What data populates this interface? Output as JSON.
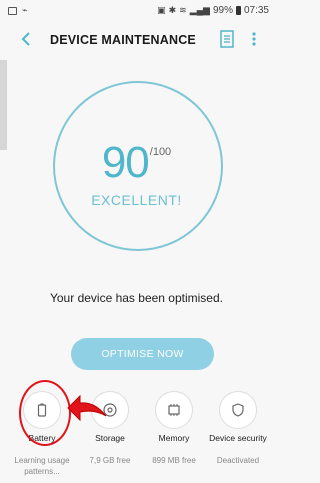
{
  "status_bar": {
    "battery_percent": "99%",
    "time": "07:35"
  },
  "header": {
    "title": "DEVICE MAINTENANCE"
  },
  "score": {
    "value": "90",
    "max": "/100",
    "status": "EXCELLENT!"
  },
  "message": "Your device has been optimised.",
  "optimise_button": "OPTIMISE NOW",
  "tiles": [
    {
      "label": "Battery",
      "sub": "Learning usage patterns...",
      "icon": "battery-icon"
    },
    {
      "label": "Storage",
      "sub": "7,9 GB free",
      "icon": "storage-icon"
    },
    {
      "label": "Memory",
      "sub": "899 MB free",
      "icon": "memory-icon"
    },
    {
      "label": "Device security",
      "sub": "Deactivated",
      "icon": "shield-icon"
    }
  ],
  "colors": {
    "accent": "#4fb6cc",
    "ring": "#7fc6d6",
    "button": "#8fd0e4",
    "annotation": "#e2141b"
  }
}
